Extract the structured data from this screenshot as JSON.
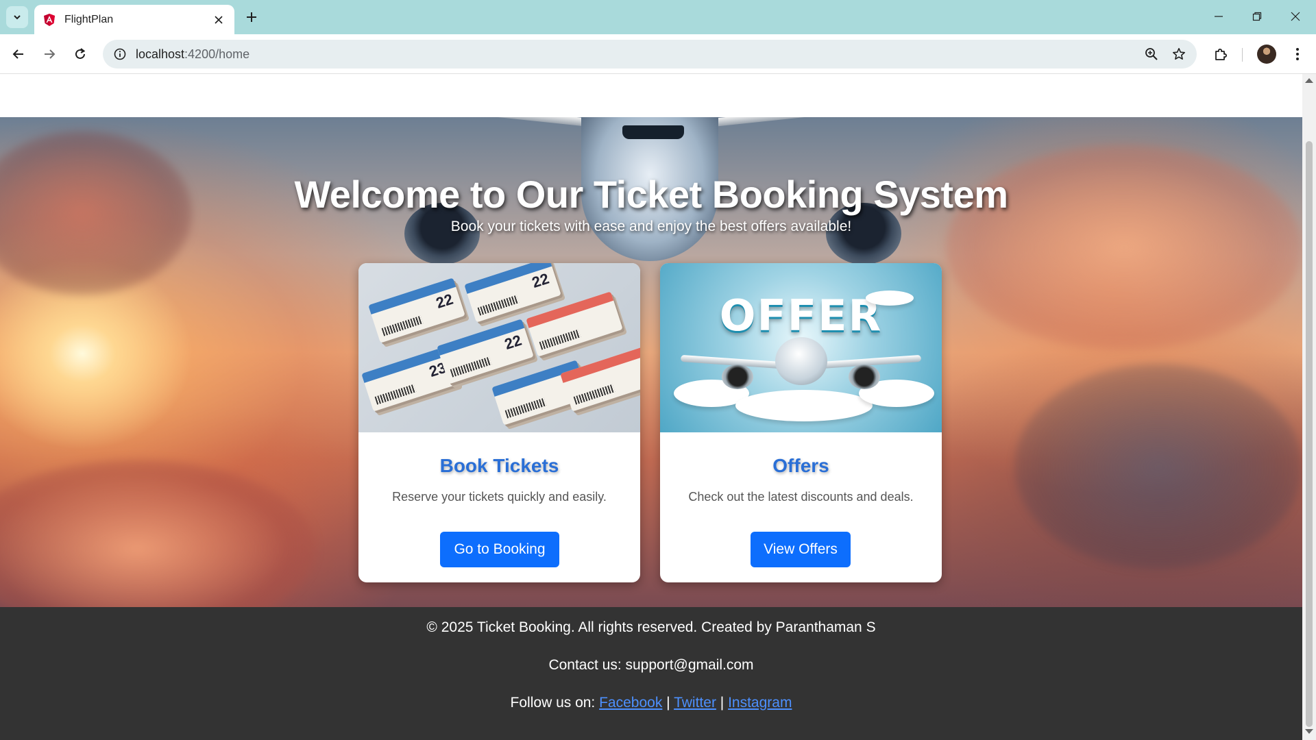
{
  "browser": {
    "tab_title": "FlightPlan",
    "url_host": "localhost",
    "url_path": ":4200/home"
  },
  "hero": {
    "title": "Welcome to Our Ticket Booking System",
    "subtitle": "Book your tickets with ease and enjoy the best offers available!"
  },
  "cards": [
    {
      "title": "Book Tickets",
      "text": "Reserve your tickets quickly and easily.",
      "button": "Go to Booking"
    },
    {
      "title": "Offers",
      "text": "Check out the latest discounts and deals.",
      "button": "View Offers",
      "image_text": "OFFER"
    }
  ],
  "ticket_image_numbers": [
    "22",
    "22",
    "23",
    "22"
  ],
  "footer": {
    "copyright": "© 2025 Ticket Booking. All rights reserved. Created by Paranthaman S",
    "contact": "Contact us: support@gmail.com",
    "follow_label": "Follow us on: ",
    "links": [
      "Facebook",
      "Twitter",
      "Instagram"
    ],
    "separator": " | "
  },
  "colors": {
    "tabstrip": "#a9dadb",
    "button": "#0d6efd",
    "card_title": "#2a6fd6",
    "footer_bg": "#333333",
    "link": "#4d90fe"
  },
  "icons": {
    "tab_search": "chevron-down-icon",
    "favicon": "angular-icon",
    "tab_close": "close-icon",
    "new_tab": "plus-icon",
    "minimize": "minimize-icon",
    "restore": "restore-icon",
    "close_window": "close-icon",
    "back": "arrow-left-icon",
    "forward": "arrow-right-icon",
    "reload": "reload-icon",
    "site_info": "info-icon",
    "zoom": "zoom-icon",
    "bookmark": "star-icon",
    "extensions": "puzzle-icon",
    "menu": "more-vertical-icon"
  }
}
